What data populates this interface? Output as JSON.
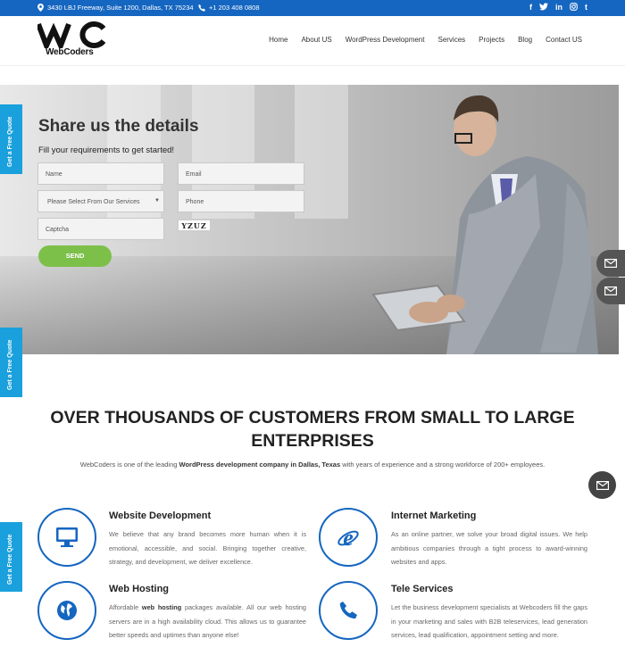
{
  "topbar": {
    "address": "3430 LBJ Freeway, Suite 1200, Dallas, TX 75234",
    "phone": "+1 203 408 0808",
    "socials": [
      "f",
      "t",
      "in",
      "ig",
      "t"
    ],
    "bg_color": "#1566c0"
  },
  "brand": {
    "name": "WebCoders"
  },
  "nav": [
    "Home",
    "About US",
    "WordPress Development",
    "Services",
    "Projects",
    "Blog",
    "Contact US"
  ],
  "hero": {
    "title": "Share us the details",
    "subtitle": "Fill your requirements to get started!",
    "name_placeholder": "Name",
    "email_placeholder": "Email",
    "service_select": "Please Select From Our Services",
    "phone_placeholder": "Phone",
    "captcha_placeholder": "Captcha",
    "captcha_code": "YZUZ",
    "send_label": "SEND"
  },
  "side_tab_label": "Get a Free Quote",
  "headline": "OVER THOUSANDS OF CUSTOMERS FROM SMALL TO LARGE ENTERPRISES",
  "intro": {
    "pre": "WebCoders is one of the leading ",
    "bold": "WordPress development company in Dallas, Texas",
    "post": " with years of experience and a strong workforce of 200+ employees."
  },
  "services": {
    "web_dev": {
      "title": "Website Development",
      "text": "We believe that any brand becomes more human when it is emotional, accessible, and social. Bringing together creative, strategy, and development, we deliver excellence."
    },
    "internet_marketing": {
      "title": "Internet Marketing",
      "text": "As an online partner, we solve your broad digital issues. We help ambitious companies through a tight process to award-winning websites and apps."
    },
    "web_hosting": {
      "title": "Web Hosting",
      "pre": "Affordable ",
      "bold": "web hosting",
      "post": " packages available. All our web hosting servers are in a high availability cloud. This allows us to guarantee better speeds and uptimes than anyone else!"
    },
    "tele_services": {
      "title": "Tele Services",
      "text": "Let the business development specialists at Webcoders fill the gaps in your marketing and sales with B2B teleservices, lead generation services, lead qualification, appointment setting and more."
    }
  },
  "colors": {
    "accent": "#1566c0",
    "send": "#7cc04a",
    "tab": "#1aa0dc"
  }
}
